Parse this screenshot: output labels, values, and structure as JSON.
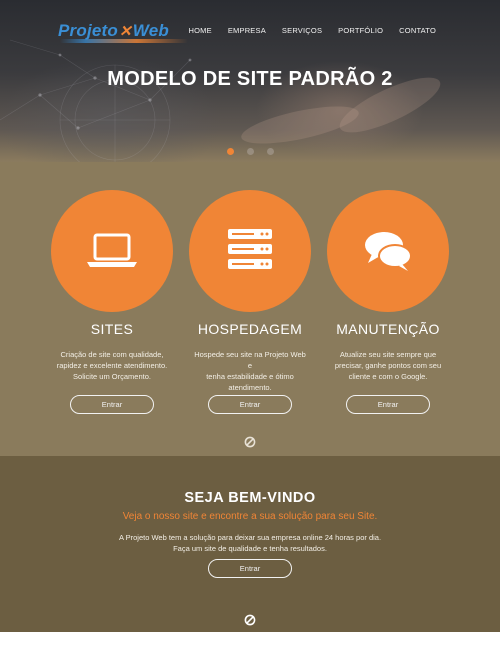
{
  "header": {
    "logo_part1": "Projeto",
    "logo_part2": "Web",
    "nav": [
      "HOME",
      "EMPRESA",
      "SERVIÇOS",
      "PORTFÓLIO",
      "CONTATO"
    ]
  },
  "hero": {
    "title": "MODELO DE SITE PADRÃO 2",
    "slides": 3,
    "active_slide": 1
  },
  "services": [
    {
      "icon": "laptop-icon",
      "title": "SITES",
      "text": [
        "Criação de site com qualidade,",
        "rapidez e excelente atendimento.",
        "Solicite um Orçamento."
      ],
      "button": "Entrar"
    },
    {
      "icon": "server-icon",
      "title": "HOSPEDAGEM",
      "text": [
        "Hospede seu site na Projeto Web e",
        "tenha estabilidade e ótimo",
        "atendimento."
      ],
      "button": "Entrar"
    },
    {
      "icon": "chat-bubbles-icon",
      "title": "MANUTENÇÃO",
      "text": [
        "Atualize seu site sempre que",
        "precisar, ganhe pontos com seu",
        "cliente e com o Google."
      ],
      "button": "Entrar"
    }
  ],
  "welcome": {
    "title": "SEJA BEM-VINDO",
    "subtitle": "Veja o nosso site e encontre a sua solução para seu Site.",
    "text": [
      "A Projeto Web tem a solução para deixar sua empresa online 24 horas por dia.",
      "Faça um site de qualidade e tenha resultados."
    ],
    "button": "Entrar"
  },
  "colors": {
    "accent": "#f08536",
    "services_bg": "#8a7b5c",
    "welcome_bg": "#6c5e41",
    "logo_blue": "#3a8fd6"
  }
}
